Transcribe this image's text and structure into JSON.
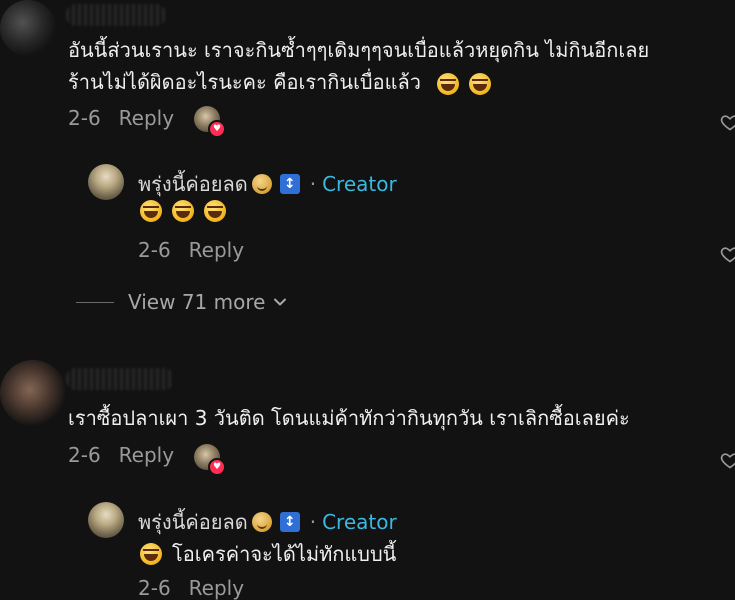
{
  "comments": [
    {
      "text_line1": "อันนี้ส่วนเรานะ เราจะกินซ้ำๆๆเดิมๆๆจนเบื่อแล้วหยุดกิน ไม่กินอีกเลย",
      "text_line2": "ร้านไม่ได้ผิดอะไรนะคะ คือเรากินเบื่อแล้ว",
      "date": "2-6",
      "reply_label": "Reply",
      "creator_reply": {
        "name": "พรุ่งนี้ค่อยลด",
        "creator_tag": "Creator",
        "separator": "·",
        "date": "2-6",
        "reply_label": "Reply"
      },
      "view_more": "View 71 more"
    },
    {
      "text_line1": "เราซื้อปลาเผา 3 วันติด โดนแม่ค้าทักว่ากินทุกวัน เราเลิกซื้อเลยค่ะ",
      "date": "2-6",
      "reply_label": "Reply",
      "creator_reply": {
        "name": "พรุ่งนี้ค่อยลด",
        "creator_tag": "Creator",
        "separator": "·",
        "text": "โอเครค่าจะได้ไม่ทักแบบนี้",
        "date": "2-6",
        "reply_label": "Reply"
      }
    }
  ],
  "icons": {
    "like": "heart-outline-icon",
    "view_more": "chevron-down-icon",
    "badge": "up-down-arrow-icon",
    "badge_glyph": "↕"
  },
  "colors": {
    "background": "#121212",
    "creator": "#3bb7e0",
    "heart": "#ff2d55",
    "meta": "#9a9a9a"
  }
}
